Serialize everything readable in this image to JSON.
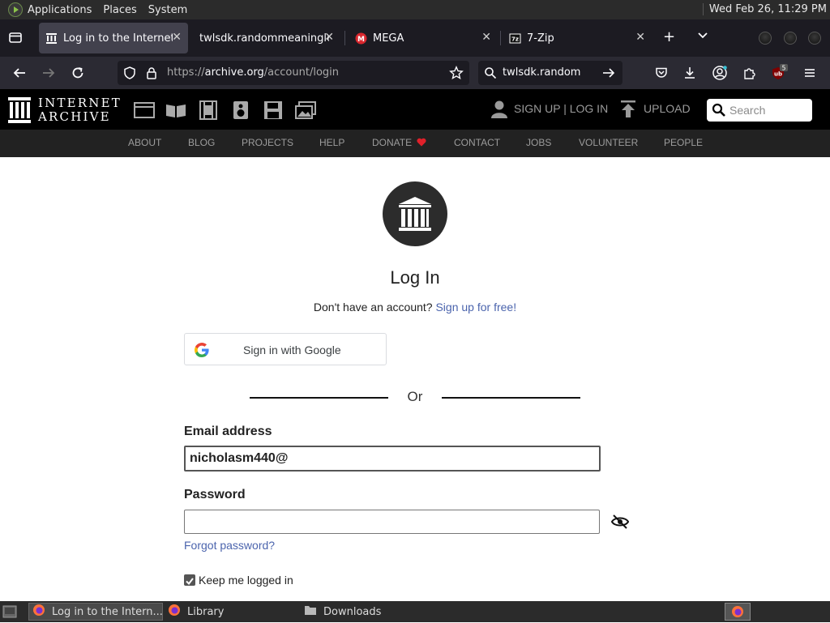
{
  "system_panel": {
    "menus": [
      "Applications",
      "Places",
      "System"
    ],
    "clock": "Wed Feb 26, 11:29 PM"
  },
  "tabs": [
    {
      "title": "Log in to the Internet A",
      "favicon": "archive-icon",
      "active": true
    },
    {
      "title": "twlsdk.randommeaningle",
      "favicon": "none",
      "active": false
    },
    {
      "title": "MEGA",
      "favicon": "mega-icon",
      "active": false
    },
    {
      "title": "7-Zip",
      "favicon": "7zip-icon",
      "active": false
    }
  ],
  "navbar": {
    "url_prefix": "https://",
    "url_host": "archive.org",
    "url_path": "/account/login",
    "search_text": "twlsdk.random",
    "extension_badge": "5"
  },
  "ia_header": {
    "logo_line1": "INTERNET",
    "logo_line2": "ARCHIVE",
    "signup_login": "SIGN UP | LOG IN",
    "upload": "UPLOAD",
    "search_placeholder": "Search",
    "nav": [
      "ABOUT",
      "BLOG",
      "PROJECTS",
      "HELP",
      "DONATE",
      "CONTACT",
      "JOBS",
      "VOLUNTEER",
      "PEOPLE"
    ]
  },
  "login": {
    "title": "Log In",
    "no_account": "Don't have an account?",
    "signup_link": "Sign up for free!",
    "google_button": "Sign in with Google",
    "or": "Or",
    "email_label": "Email address",
    "email_value": "nicholasm440@",
    "password_label": "Password",
    "forgot_link": "Forgot password?",
    "keep_logged_in": "Keep me logged in",
    "keep_checked": true
  },
  "taskbar": {
    "items": [
      "Log in to the Intern...",
      "Library",
      "Downloads"
    ]
  },
  "colors": {
    "link": "#4b64ad",
    "donate_heart": "#e0202a",
    "ia_black": "#000000"
  }
}
